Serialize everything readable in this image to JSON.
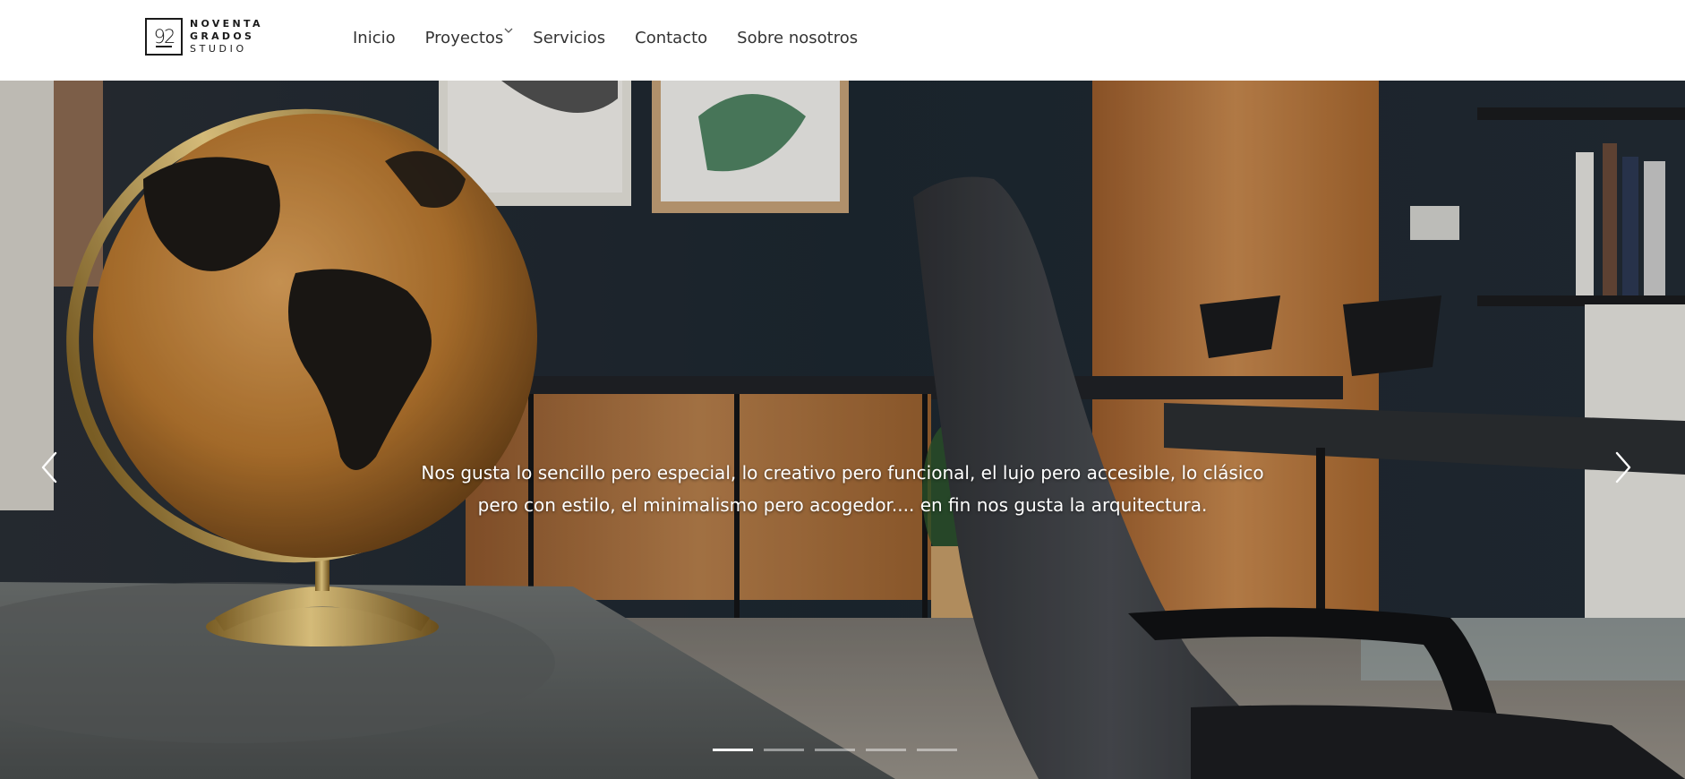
{
  "brand": {
    "mark": "92",
    "line1": "NOVENTA",
    "line2": "GRADOS",
    "line3": "STUDIO"
  },
  "nav": {
    "items": [
      {
        "label": "Inicio"
      },
      {
        "label": "Proyectos",
        "has_dropdown": true
      },
      {
        "label": "Servicios"
      },
      {
        "label": "Contacto"
      },
      {
        "label": "Sobre nosotros"
      }
    ]
  },
  "hero": {
    "caption_line1": "Nos gusta lo sencillo pero especial, lo creativo pero funcional, el lujo pero accesible, lo clásico",
    "caption_line2": "pero con estilo, el minimalismo pero acogedor.... en fin nos gusta la arquitectura.",
    "prev_icon": "chevron-left-icon",
    "next_icon": "chevron-right-icon",
    "slide_count": 5,
    "active_slide": 1
  },
  "colors": {
    "header_bg": "#ffffff",
    "nav_text": "#333333",
    "caption_text": "#ffffff",
    "wall": "#1f2a33",
    "wood": "#b9773f",
    "globe": "#c98a3c",
    "chair": "#3a3d42"
  }
}
